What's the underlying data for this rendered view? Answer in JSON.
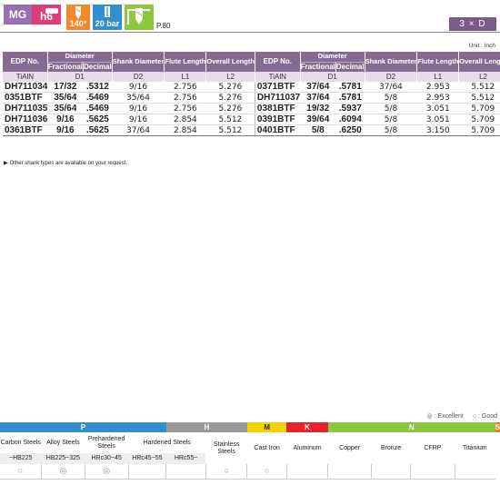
{
  "header": {
    "badges": {
      "mg": "MG",
      "h6": "h6",
      "angle": "140°",
      "pressure": "20 bar"
    },
    "page_ref": "P.80",
    "ratio": "3 × D"
  },
  "unit_label": "Unit : Inch",
  "table": {
    "columns": {
      "edp": "EDP No.",
      "diameter": "Diameter",
      "fractional": "Fractional",
      "decimal": "Decimal",
      "shank": "Shank Diameter",
      "flute": "Flute Length",
      "overall": "Overall Length",
      "coating": "TiAlN",
      "d1": "D1",
      "d2": "D2",
      "l1": "L1",
      "l2": "L2"
    },
    "left_rows": [
      {
        "edp": "DH711034",
        "frac": "17/32",
        "dec": ".5312",
        "shank": "9/16",
        "flute": "2.756",
        "overall": "5.276"
      },
      {
        "edp": "0351BTF",
        "frac": "35/64",
        "dec": ".5469",
        "shank": "35/64",
        "flute": "2.756",
        "overall": "5.276"
      },
      {
        "edp": "DH711035",
        "frac": "35/64",
        "dec": ".5469",
        "shank": "9/16",
        "flute": "2.756",
        "overall": "5.276"
      },
      {
        "edp": "DH711036",
        "frac": "9/16",
        "dec": ".5625",
        "shank": "9/16",
        "flute": "2.854",
        "overall": "5.512"
      },
      {
        "edp": "0361BTF",
        "frac": "9/16",
        "dec": ".5625",
        "shank": "37/64",
        "flute": "2.854",
        "overall": "5.512"
      }
    ],
    "right_rows": [
      {
        "edp": "0371BTF",
        "frac": "37/64",
        "dec": ".5781",
        "shank": "37/64",
        "flute": "2.953",
        "overall": "5.512"
      },
      {
        "edp": "DH711037",
        "frac": "37/64",
        "dec": ".5781",
        "shank": "5/8",
        "flute": "2.953",
        "overall": "5.512"
      },
      {
        "edp": "0381BTF",
        "frac": "19/32",
        "dec": ".5937",
        "shank": "5/8",
        "flute": "3.051",
        "overall": "5.709"
      },
      {
        "edp": "0391BTF",
        "frac": "39/64",
        "dec": ".6094",
        "shank": "5/8",
        "flute": "3.051",
        "overall": "5.709"
      },
      {
        "edp": "0401BTF",
        "frac": "5/8",
        "dec": ".6250",
        "shank": "5/8",
        "flute": "3.150",
        "overall": "5.709"
      }
    ]
  },
  "note": "Other shank types are available on your request.",
  "legend": {
    "excellent": "◎ : Excellent",
    "good": "○ : Good"
  },
  "materials": {
    "groups": [
      {
        "code": "P",
        "color": "#2f8fd0",
        "span": 4
      },
      {
        "code": "H",
        "color": "#9a9a9a",
        "span": 2
      },
      {
        "code": "M",
        "color": "#f2d200",
        "span": 1
      },
      {
        "code": "K",
        "color": "#e8232a",
        "span": 1
      },
      {
        "code": "N",
        "color": "#8dc63f",
        "span": 5
      },
      {
        "code": "S",
        "color": "#e87d1e",
        "span": 1
      }
    ],
    "names": {
      "carbon": "Carbon Steels",
      "alloy": "Alloy Steels",
      "prehardened": "Prehardened Steels",
      "hardened": "Hardened Steels",
      "stainless": "Stainless Steels",
      "cast_iron": "Cast Iron",
      "aluminum": "Aluminum",
      "copper": "Copper",
      "bronze": "Bronze",
      "cfrp": "CFRP",
      "titanium": "Titanium"
    },
    "hardness": {
      "carbon": "~HB225",
      "alloy": "HB225~325",
      "prehardened": "HRc30~45",
      "hardened_1": "HRc45~55",
      "hardened_2": "HRc55~"
    },
    "marks": [
      "○",
      "◎",
      "◎",
      "",
      "",
      "○",
      "○",
      "",
      "",
      "",
      "",
      ""
    ]
  }
}
